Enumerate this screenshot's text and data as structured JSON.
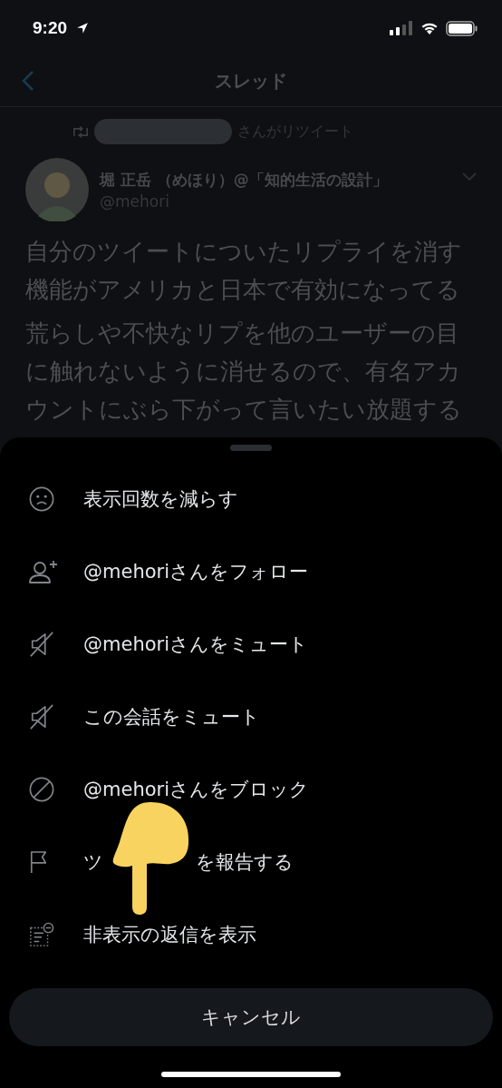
{
  "status_bar": {
    "time": "9:20"
  },
  "nav": {
    "title": "スレッド"
  },
  "tweet": {
    "retweet_label": "さんがリツイート",
    "author_name": "堀 正岳 （めほり）@「知的生活の設計」",
    "handle": "@mehori",
    "paragraphs": [
      "自分のツイートについたリプライを消す機能がアメリカと日本で有効になってる",
      "荒らしや不快なリプを他のユーザーの目に触れないように消せるので、有名アカウントにぶら下がって言いたい放題する"
    ]
  },
  "menu": {
    "items": [
      {
        "kind": "frown",
        "label": "表示回数を減らす"
      },
      {
        "kind": "follow",
        "label": "@mehoriさんをフォロー"
      },
      {
        "kind": "mute",
        "label": "@mehoriさんをミュート"
      },
      {
        "kind": "mute",
        "label": "この会話をミュート"
      },
      {
        "kind": "block",
        "label": "@mehoriさんをブロック"
      },
      {
        "kind": "report",
        "label_parts": [
          "ツ",
          "を報告する"
        ]
      },
      {
        "kind": "hidden",
        "label": "非表示の返信を表示"
      }
    ],
    "cancel": "キャンセル"
  }
}
